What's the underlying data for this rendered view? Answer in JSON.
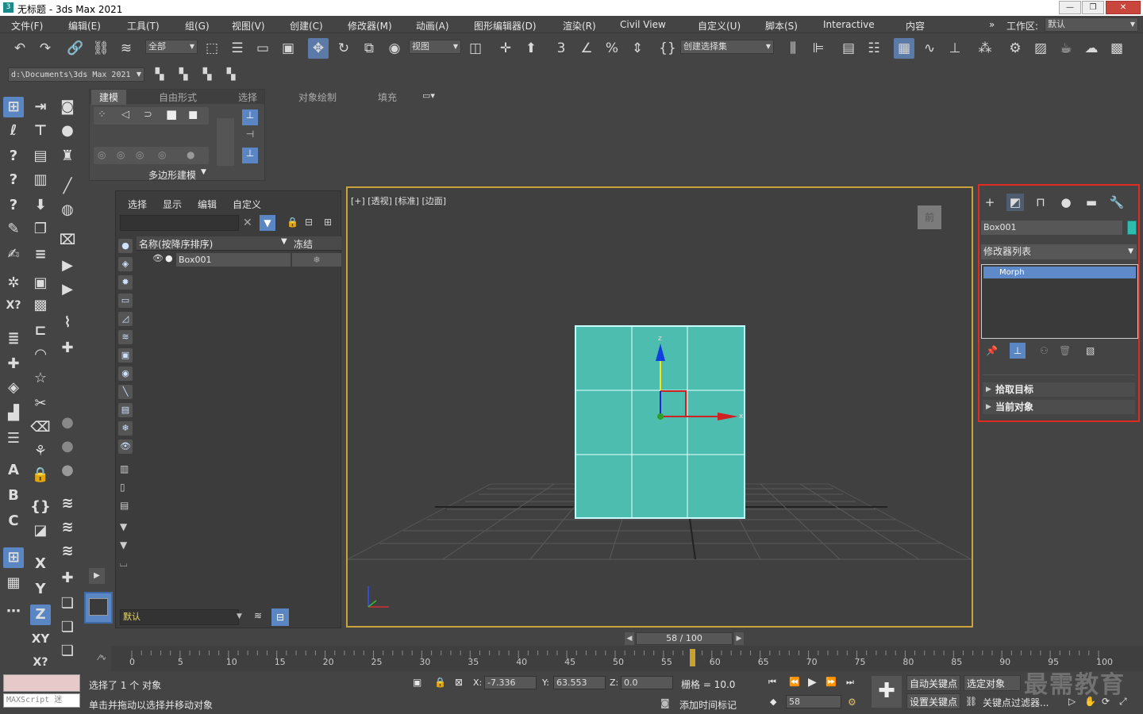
{
  "window": {
    "title": "无标题 - 3ds Max 2021"
  },
  "menu": [
    "文件(F)",
    "编辑(E)",
    "工具(T)",
    "组(G)",
    "视图(V)",
    "创建(C)",
    "修改器(M)",
    "动画(A)",
    "图形编辑器(D)",
    "渲染(R)",
    "Civil View",
    "自定义(U)",
    "脚本(S)",
    "Interactive",
    "内容"
  ],
  "workspace": {
    "label": "工作区:",
    "value": "默认"
  },
  "toolbar": {
    "filter_value": "全部",
    "refcoord_value": "视图",
    "selset_placeholder": "创建选择集",
    "project_path": "d:\\Documents\\3ds Max 2021"
  },
  "ribbon": {
    "tabs": [
      "建模",
      "自由形式",
      "选择",
      "对象绘制",
      "填充"
    ],
    "panel_label": "多边形建模"
  },
  "explorer": {
    "tabs": [
      "选择",
      "显示",
      "编辑",
      "自定义"
    ],
    "col_name": "名称(按降序排序)",
    "col_freeze": "冻结",
    "row_name": "Box001",
    "layer": "默认"
  },
  "viewport": {
    "label": "[+] [透视] [标准] [边面]",
    "viewcube_label": "前"
  },
  "command_panel": {
    "object_name": "Box001",
    "object_color": "#2fbcae",
    "modifier_list": "修改器列表",
    "stack_item": "Morph",
    "rollouts": [
      "拾取目标",
      "当前对象"
    ]
  },
  "timeline": {
    "slider_text": "58 / 100",
    "current_frame": 58,
    "ticks": [
      "0",
      "5",
      "10",
      "15",
      "20",
      "25",
      "30",
      "35",
      "40",
      "45",
      "50",
      "55",
      "60",
      "65",
      "70",
      "75",
      "80",
      "85",
      "90",
      "95",
      "100"
    ]
  },
  "status": {
    "maxscript": "MAXScript 迷",
    "selection": "选择了 1 个 对象",
    "prompt": "单击并拖动以选择并移动对象",
    "x_label": "X:",
    "x": "-7.336",
    "y_label": "Y:",
    "y": "63.553",
    "z_label": "Z:",
    "z": "0.0",
    "grid": "栅格 = 10.0",
    "add_time_tag": "添加时间标记",
    "auto_key": "自动关键点",
    "set_key": "设置关键点",
    "selected_object": "选定对象",
    "key_filters": "关键点过滤器...",
    "frame_field": "58"
  },
  "watermark": "最需教育",
  "colors": {
    "accent": "#5a86c4",
    "viewport_border": "#c8a23a",
    "highlight_box": "#e02b20"
  }
}
